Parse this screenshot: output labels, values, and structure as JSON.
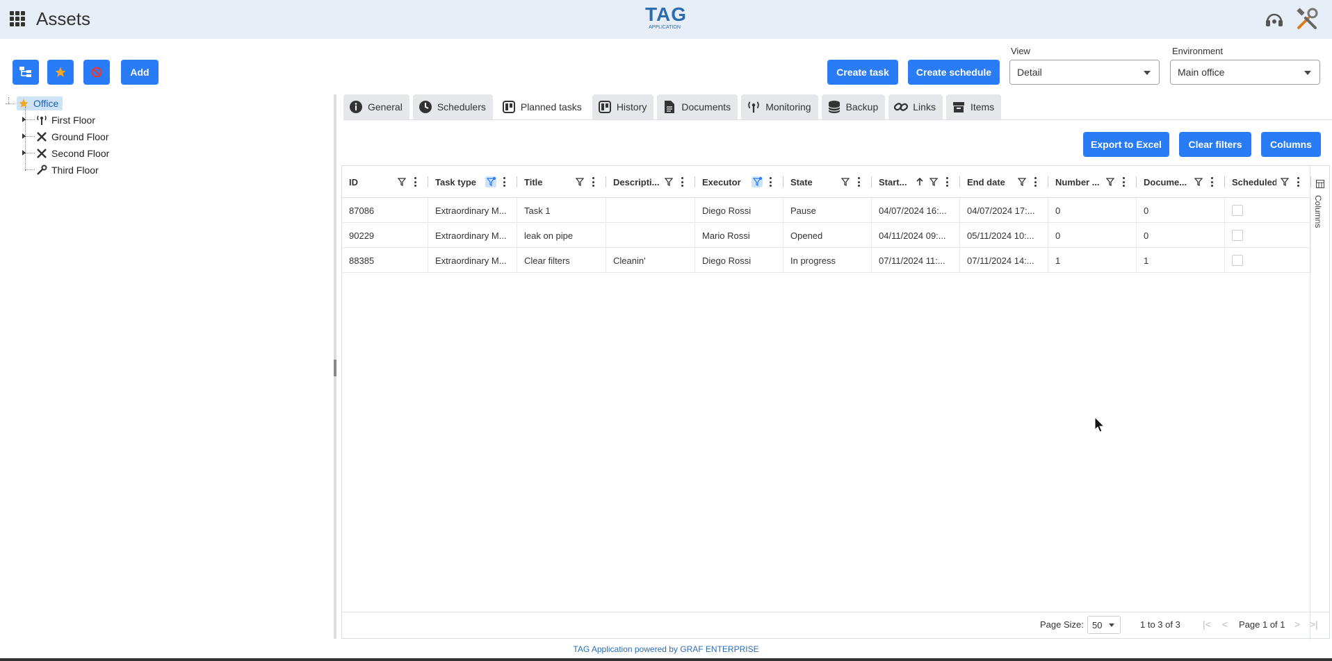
{
  "header": {
    "title": "Assets",
    "logo_main": "TAG",
    "logo_sub": "APPLICATION"
  },
  "toolbar": {
    "add_label": "Add",
    "create_task_label": "Create task",
    "create_schedule_label": "Create schedule",
    "view_label": "View",
    "view_value": "Detail",
    "environment_label": "Environment",
    "environment_value": "Main office"
  },
  "tree": {
    "root": "Office",
    "children": [
      "First Floor",
      "Ground Floor",
      "Second Floor",
      "Third Floor"
    ]
  },
  "tabs": [
    "General",
    "Schedulers",
    "Planned tasks",
    "History",
    "Documents",
    "Monitoring",
    "Backup",
    "Links",
    "Items"
  ],
  "active_tab": "Planned tasks",
  "grid_actions": {
    "export_label": "Export to Excel",
    "clear_filters_label": "Clear filters",
    "columns_label": "Columns"
  },
  "grid": {
    "columns": [
      "ID",
      "Task type",
      "Title",
      "Descripti...",
      "Executor",
      "State",
      "Start...",
      "End date",
      "Number ...",
      "Docume...",
      "Scheduled"
    ],
    "rows": [
      [
        "87086",
        "Extraordinary M...",
        "Task 1",
        "",
        "Diego Rossi",
        "Pause",
        "04/07/2024 16:...",
        "04/07/2024 17:...",
        "0",
        "0"
      ],
      [
        "90229",
        "Extraordinary M...",
        "leak on pipe",
        "",
        "Mario Rossi",
        "Opened",
        "04/11/2024 09:...",
        "05/11/2024 10:...",
        "0",
        "0"
      ],
      [
        "88385",
        "Extraordinary M...",
        "Clear filters",
        "Cleanin'",
        "Diego Rossi",
        "In progress",
        "07/11/2024 11:...",
        "07/11/2024 14:...",
        "1",
        "1"
      ]
    ],
    "side_panel_label": "Columns"
  },
  "pager": {
    "page_size_label": "Page Size:",
    "page_size_value": "50",
    "range_text": "1 to 3 of 3",
    "page_text": "Page 1 of 1"
  },
  "footer": {
    "text": "TAG Application powered by GRAF ENTERPRISE"
  },
  "colors": {
    "accent": "#2a7cf6",
    "topbar": "#e8eef8",
    "selection": "#cfe3f6"
  }
}
